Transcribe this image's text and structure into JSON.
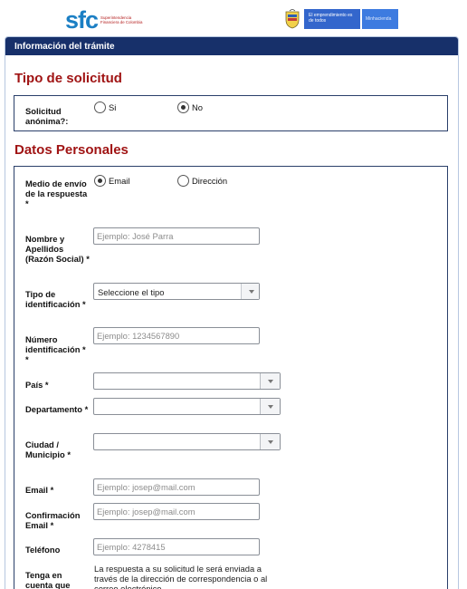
{
  "header": {
    "sfc_logo_text": "sfc",
    "sfc_logo_subtitle": "Superintendencia Financiera de Colombia",
    "gov_text": "El emprendimiento es de todos",
    "gov_ministry": "Minhacienda"
  },
  "panel": {
    "title": "Información del trámite"
  },
  "tipo_solicitud": {
    "title": "Tipo de solicitud",
    "anonima_label": "Solicitud anónima?:",
    "options": [
      "Si",
      "No"
    ],
    "selected": "No"
  },
  "datos_personales": {
    "title": "Datos Personales",
    "medio_envio": {
      "label": "Medio de envío de la respuesta *",
      "options": [
        "Email",
        "Dirección"
      ],
      "selected": "Email"
    },
    "nombre": {
      "label": "Nombre y Apellidos (Razón Social) *",
      "placeholder": "Ejemplo: José Parra",
      "value": ""
    },
    "tipo_identificacion": {
      "label": "Tipo de identificación *",
      "value": "Seleccione el tipo"
    },
    "numero_identificacion": {
      "label": "Número identificación * *",
      "placeholder": "Ejemplo: 1234567890",
      "value": ""
    },
    "pais": {
      "label": "País *",
      "value": ""
    },
    "departamento": {
      "label": "Departamento *",
      "value": ""
    },
    "ciudad": {
      "label": "Ciudad / Municipio *",
      "value": ""
    },
    "email": {
      "label": "Email *",
      "placeholder": "Ejemplo: josep@mail.com",
      "value": ""
    },
    "confirmacion_email": {
      "label": "Confirmación Email *",
      "placeholder": "Ejemplo: josep@mail.com",
      "value": ""
    },
    "telefono": {
      "label": "Teléfono",
      "placeholder": "Ejemplo: 4278415",
      "value": ""
    },
    "tenga_en_cuenta": {
      "label": "Tenga en cuenta que",
      "text": "La respuesta a su solicitud le será enviada a través de la dirección de correspondencia o al correo electrónico"
    }
  }
}
